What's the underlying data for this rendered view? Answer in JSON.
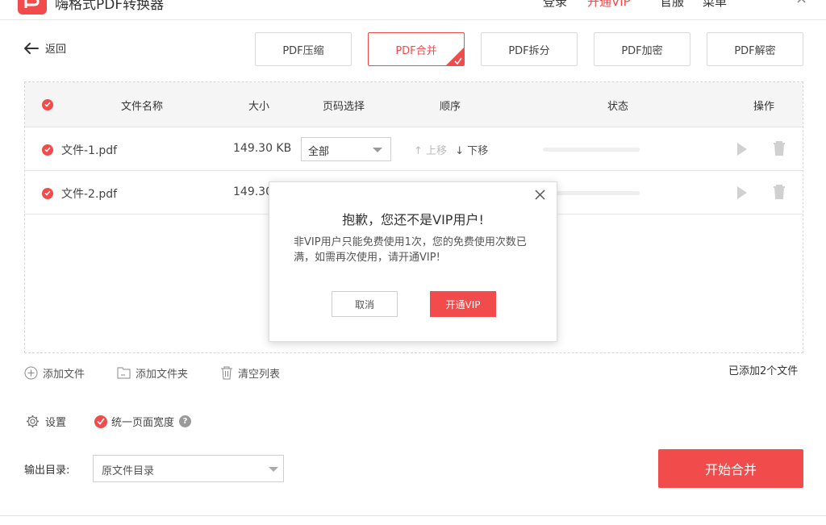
{
  "titlebar": {
    "app_title": "嗨格式PDF转换器",
    "nav": [
      "登录",
      "开通VIP",
      "官服",
      "菜单"
    ]
  },
  "back": {
    "label": "返回"
  },
  "tabs": [
    {
      "label": "PDF压缩",
      "active": false
    },
    {
      "label": "PDF合并",
      "active": true
    },
    {
      "label": "PDF拆分",
      "active": false
    },
    {
      "label": "PDF加密",
      "active": false
    },
    {
      "label": "PDF解密",
      "active": false
    }
  ],
  "table": {
    "headers": {
      "name": "文件名称",
      "size": "大小",
      "pages": "页码选择",
      "order": "顺序",
      "status": "状态",
      "ops": "操作"
    },
    "rows": [
      {
        "name": "文件-1.pdf",
        "size": "149.30 KB",
        "pages": "全部",
        "up": "上移",
        "down": "下移"
      },
      {
        "name": "文件-2.pdf",
        "size": "149.30"
      }
    ]
  },
  "toolbar": {
    "add_file": "添加文件",
    "add_folder": "添加文件夹",
    "clear": "清空列表",
    "count": "已添加2个文件"
  },
  "settings": {
    "label": "设置",
    "uniform_width": "统一页面宽度",
    "help": "?"
  },
  "output": {
    "label": "输出目录:",
    "value": "原文件目录"
  },
  "start_button": "开始合并",
  "modal": {
    "title": "抱歉，您还不是VIP用户!",
    "body": "非VIP用户只能免费使用1次，您的免费使用次数已满，如需再次使用，请开通VIP!",
    "cancel": "取消",
    "ok": "开通VIP"
  },
  "colors": {
    "accent": "#f24b4b"
  }
}
